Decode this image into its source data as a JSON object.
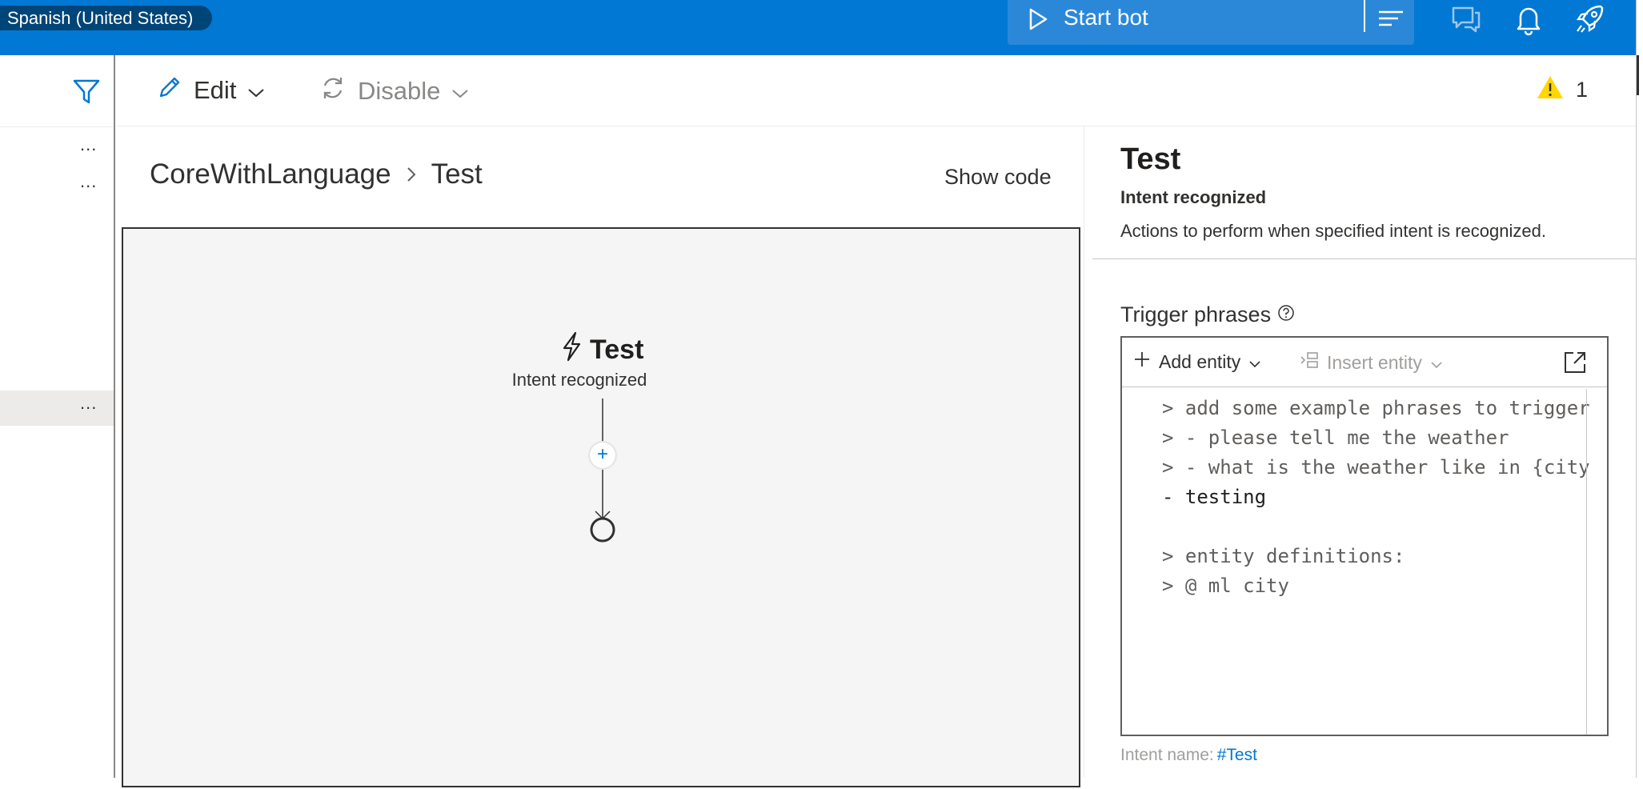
{
  "header": {
    "locale": "Spanish (United States)",
    "start_bot_label": "Start bot"
  },
  "toolbar": {
    "edit_label": "Edit",
    "disable_label": "Disable",
    "warning_count": "1"
  },
  "leftnav": {
    "row_menu": "..."
  },
  "breadcrumb": {
    "root": "CoreWithLanguage",
    "separator": ">",
    "current": "Test"
  },
  "show_code_label": "Show code",
  "canvas": {
    "node_title": "Test",
    "node_subtitle": "Intent recognized",
    "add_symbol": "+"
  },
  "panel": {
    "title": "Test",
    "subtitle": "Intent recognized",
    "description": "Actions to perform when specified intent is recognized.",
    "trigger_label": "Trigger phrases",
    "add_entity_label": "Add entity",
    "insert_entity_label": "Insert entity",
    "code_lines": [
      "> add some example phrases to trigger",
      "> - please tell me the weather",
      "> - what is the weather like in {city",
      "- testing",
      "",
      "> entity definitions:",
      "> @ ml city"
    ],
    "intent_name_label": "Intent name:",
    "intent_name_value": "#Test"
  },
  "colors": {
    "brand": "#0078d4",
    "warning": "#ffd600"
  }
}
